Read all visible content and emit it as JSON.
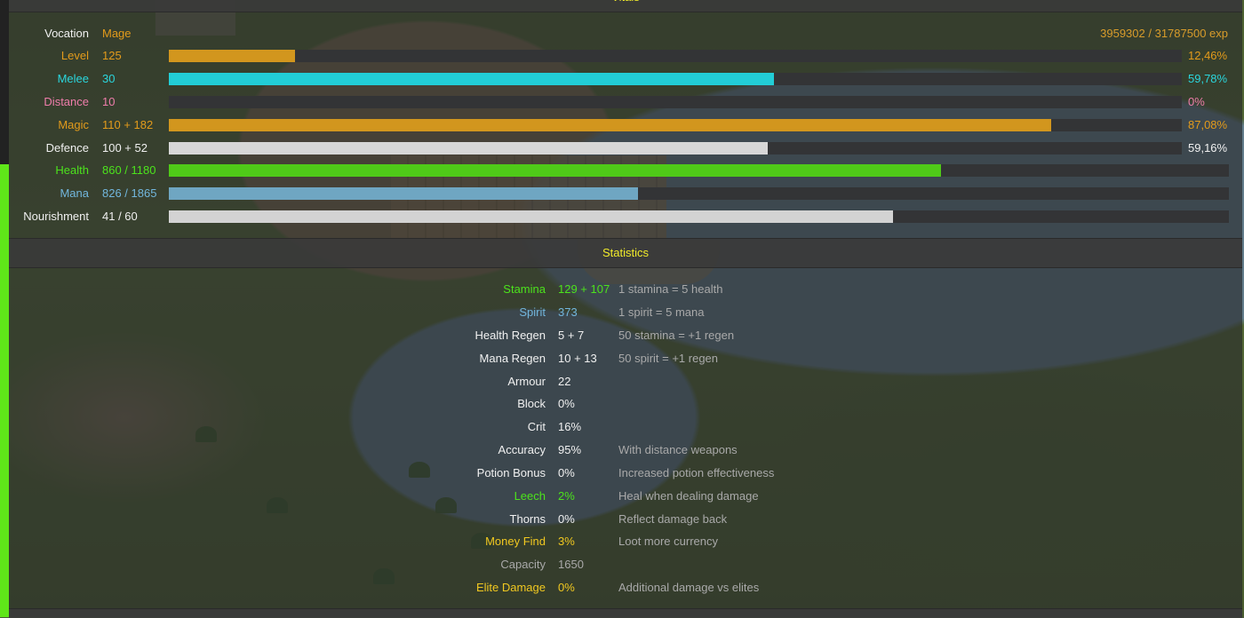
{
  "vitals": {
    "title": "Vitals",
    "vocation": {
      "label": "Vocation",
      "value": "Mage"
    },
    "exp_text": "3959302 / 31787500 exp",
    "rows": [
      {
        "label": "Level",
        "value": "125",
        "pct_text": "12,46%",
        "fill": 0.1246,
        "color": "#d2961e"
      },
      {
        "label": "Melee",
        "value": "30",
        "pct_text": "59,78%",
        "fill": 0.5978,
        "color": "#22cdd6"
      },
      {
        "label": "Distance",
        "value": "10",
        "pct_text": "0%",
        "fill": 0.0,
        "color": "#e57aa6"
      },
      {
        "label": "Magic",
        "value": "110 + 182",
        "pct_text": "87,08%",
        "fill": 0.8708,
        "color": "#d2961e"
      },
      {
        "label": "Defence",
        "value": "100 + 52",
        "pct_text": "59,16%",
        "fill": 0.5916,
        "color": "#d7d7d7"
      },
      {
        "label": "Health",
        "value": "860 / 1180",
        "pct_text": "",
        "fill": 0.7288,
        "color": "#4fca18"
      },
      {
        "label": "Mana",
        "value": "826 / 1865",
        "pct_text": "",
        "fill": 0.4429,
        "color": "#6fa6c2"
      },
      {
        "label": "Nourishment",
        "value": "41 / 60",
        "pct_text": "",
        "fill": 0.6833,
        "color": "#d3d3d3"
      }
    ]
  },
  "statistics": {
    "title": "Statistics",
    "rows": [
      {
        "label": "Stamina",
        "value": "129 + 107",
        "note": "1 stamina = 5 health"
      },
      {
        "label": "Spirit",
        "value": "373",
        "note": "1 spirit = 5 mana"
      },
      {
        "label": "Health Regen",
        "value": "5 + 7",
        "note": "50 stamina = +1 regen"
      },
      {
        "label": "Mana Regen",
        "value": "10 + 13",
        "note": "50 spirit = +1 regen"
      },
      {
        "label": "Armour",
        "value": "22",
        "note": ""
      },
      {
        "label": "Block",
        "value": "0%",
        "note": ""
      },
      {
        "label": "Crit",
        "value": "16%",
        "note": ""
      },
      {
        "label": "Accuracy",
        "value": "95%",
        "note": "With distance weapons"
      },
      {
        "label": "Potion Bonus",
        "value": "0%",
        "note": "Increased potion effectiveness"
      },
      {
        "label": "Leech",
        "value": "2%",
        "note": "Heal when dealing damage"
      },
      {
        "label": "Thorns",
        "value": "0%",
        "note": "Reflect damage back"
      },
      {
        "label": "Money Find",
        "value": "3%",
        "note": "Loot more currency"
      },
      {
        "label": "Capacity",
        "value": "1650",
        "note": ""
      },
      {
        "label": "Elite Damage",
        "value": "0%",
        "note": "Additional damage vs elites"
      }
    ]
  }
}
